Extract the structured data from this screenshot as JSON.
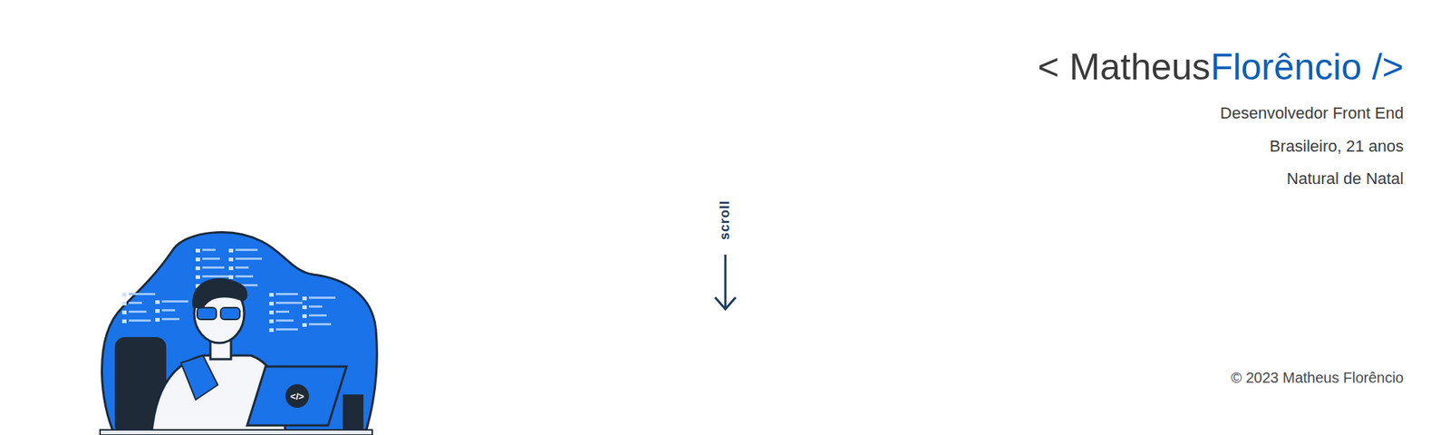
{
  "header": {
    "name_first": "< Matheus",
    "name_last": "Florêncio />"
  },
  "details": [
    "Desenvolvedor Front End",
    "Brasileiro, 21 anos",
    "Natural de Natal"
  ],
  "scroll": {
    "label": "scroll"
  },
  "illustration": {
    "laptop_glyph": "</>"
  },
  "footer": {
    "text": "© 2023 Matheus Florêncio"
  }
}
